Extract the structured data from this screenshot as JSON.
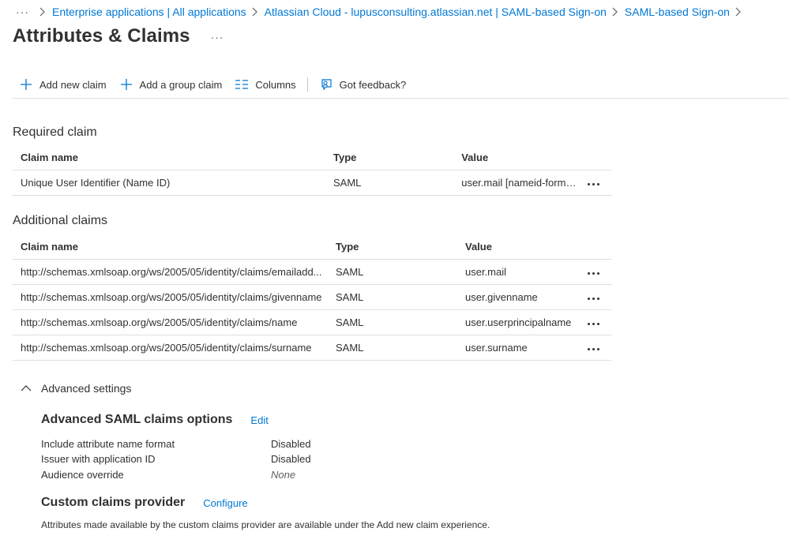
{
  "breadcrumb": {
    "items": [
      "Enterprise applications | All applications",
      "Atlassian Cloud - lupusconsulting.atlassian.net | SAML-based Sign-on",
      "SAML-based Sign-on"
    ]
  },
  "page": {
    "title": "Attributes & Claims"
  },
  "toolbar": {
    "add_new_claim": "Add new claim",
    "add_group_claim": "Add a group claim",
    "columns": "Columns",
    "feedback": "Got feedback?"
  },
  "required": {
    "title": "Required claim",
    "headers": [
      "Claim name",
      "Type",
      "Value"
    ],
    "rows": [
      {
        "name": "Unique User Identifier (Name ID)",
        "type": "SAML",
        "value": "user.mail [nameid-forma..."
      }
    ]
  },
  "additional": {
    "title": "Additional claims",
    "headers": [
      "Claim name",
      "Type",
      "Value"
    ],
    "rows": [
      {
        "name": "http://schemas.xmlsoap.org/ws/2005/05/identity/claims/emailadd...",
        "type": "SAML",
        "value": "user.mail"
      },
      {
        "name": "http://schemas.xmlsoap.org/ws/2005/05/identity/claims/givenname",
        "type": "SAML",
        "value": "user.givenname"
      },
      {
        "name": "http://schemas.xmlsoap.org/ws/2005/05/identity/claims/name",
        "type": "SAML",
        "value": "user.userprincipalname"
      },
      {
        "name": "http://schemas.xmlsoap.org/ws/2005/05/identity/claims/surname",
        "type": "SAML",
        "value": "user.surname"
      }
    ]
  },
  "advanced": {
    "toggle_label": "Advanced settings",
    "saml_options": {
      "title": "Advanced SAML claims options",
      "edit_label": "Edit",
      "items": [
        {
          "label": "Include attribute name format",
          "value": "Disabled"
        },
        {
          "label": "Issuer with application ID",
          "value": "Disabled"
        },
        {
          "label": "Audience override",
          "value": "None"
        }
      ]
    },
    "custom_provider": {
      "title": "Custom claims provider",
      "configure_label": "Configure",
      "note": "Attributes made available by the custom claims provider are available under the Add new claim experience."
    }
  },
  "colors": {
    "link": "#0078d4",
    "text": "#323130",
    "border": "#e1dfdd"
  }
}
